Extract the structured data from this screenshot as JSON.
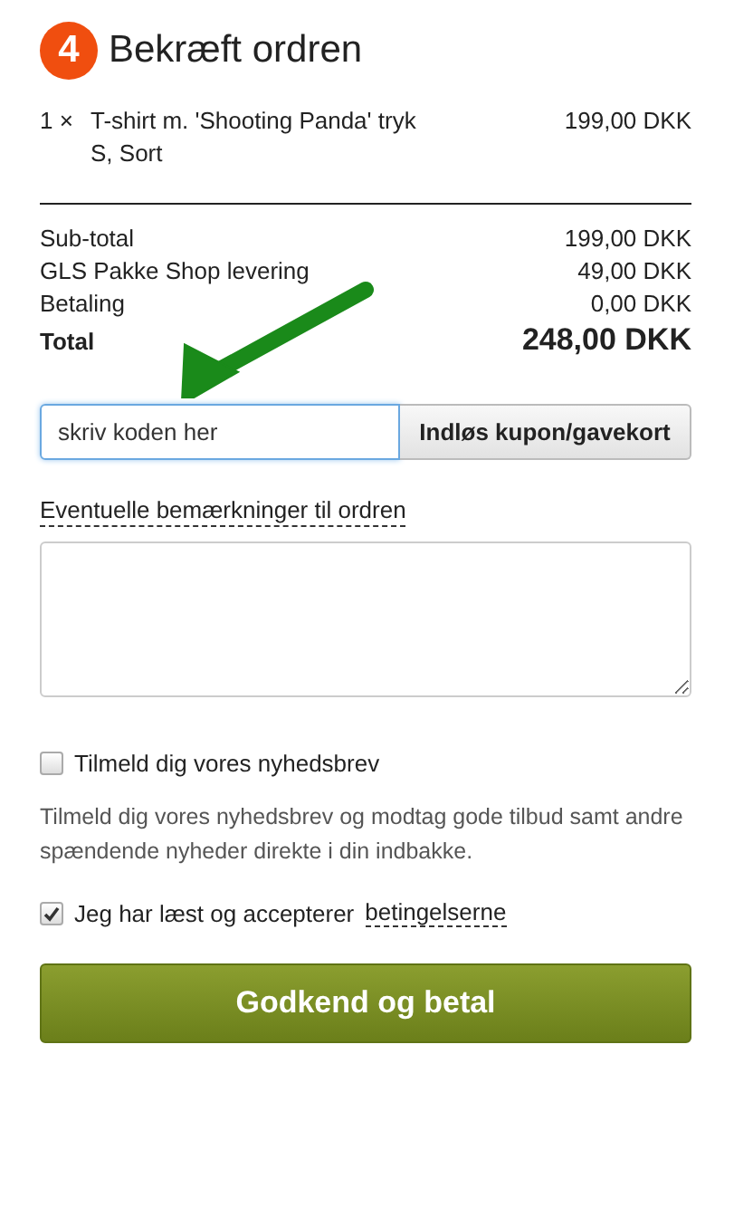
{
  "step": {
    "number": "4",
    "title": "Bekræft ordren"
  },
  "items": [
    {
      "quantity": "1 ×",
      "name": "T-shirt m. 'Shooting Panda' tryk",
      "variant": "S, Sort",
      "price": "199,00 DKK"
    }
  ],
  "summary": [
    {
      "kind": "line",
      "label": "Sub-total",
      "amount": "199,00 DKK"
    },
    {
      "kind": "line",
      "label": "GLS Pakke Shop levering",
      "amount": "49,00 DKK"
    },
    {
      "kind": "line",
      "label": "Betaling",
      "amount": "0,00 DKK"
    },
    {
      "kind": "total",
      "label": "Total",
      "amount": "248,00 DKK"
    }
  ],
  "coupon": {
    "value": "skriv koden her",
    "button": "Indløs kupon/gavekort"
  },
  "remarks": {
    "label": "Eventuelle bemærkninger til ordren"
  },
  "newsletter": {
    "label": "Tilmeld dig vores nyhedsbrev",
    "checked": false,
    "description": "Tilmeld dig vores nyhedsbrev og modtag gode tilbud samt andre spændende nyheder direkte i din indbakke."
  },
  "terms": {
    "label": "Jeg har læst og accepterer",
    "link": "betingelserne",
    "checked": true
  },
  "submit": {
    "label": "Godkend og betal"
  }
}
